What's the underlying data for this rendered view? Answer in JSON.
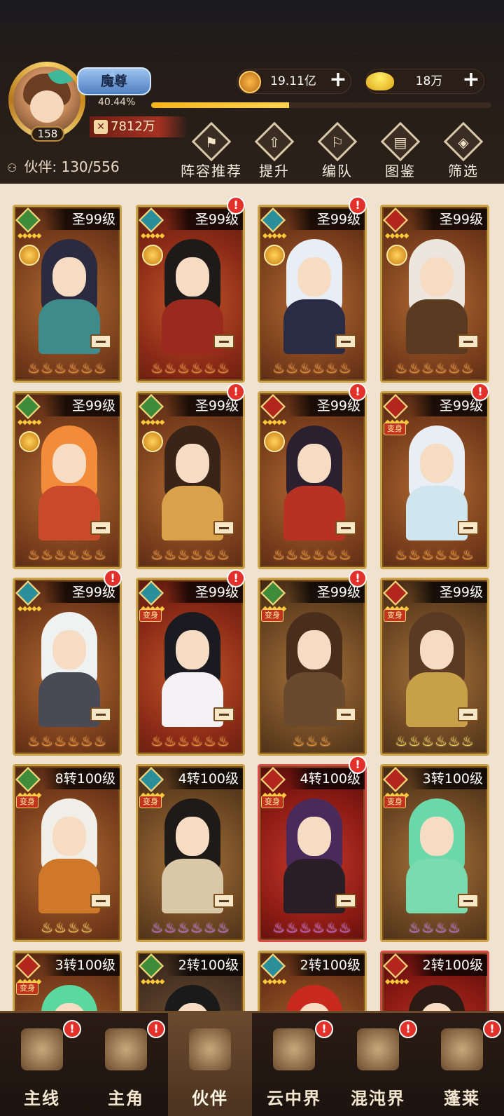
{
  "player": {
    "level": "158",
    "rank": "魔尊",
    "exp_percent": "40.44%",
    "exp_fraction": 0.4044,
    "power": "7812万"
  },
  "currency": {
    "coins": "19.11亿",
    "ingots": "18万"
  },
  "partners": {
    "label": "伙伴:",
    "count": "130/556"
  },
  "toolbar": [
    {
      "label": "阵容推荐",
      "icon": "lineup-icon"
    },
    {
      "label": "提升",
      "icon": "upgrade-icon"
    },
    {
      "label": "编队",
      "icon": "formation-icon"
    },
    {
      "label": "图鉴",
      "icon": "codex-icon"
    },
    {
      "label": "筛选",
      "icon": "filter-icon"
    }
  ],
  "transform_label": "变身",
  "alert_glyph": "!",
  "cards": [
    {
      "level": "圣99级",
      "element": "green",
      "bg": "d",
      "flames": "orange",
      "flame_count": 6,
      "medal": true,
      "hair": "#2b2a3e",
      "body": "#3f8a8a",
      "alert": false
    },
    {
      "level": "圣99级",
      "element": "teal",
      "bg": "r",
      "flames": "orange",
      "flame_count": 6,
      "medal": true,
      "hair": "#1e1a1a",
      "body": "#9a2a1e",
      "alert": true
    },
    {
      "level": "圣99级",
      "element": "teal",
      "bg": "d",
      "flames": "orange",
      "flame_count": 6,
      "medal": true,
      "hair": "#e8eef6",
      "body": "#2a2b44",
      "alert": true
    },
    {
      "level": "圣99级",
      "element": "red",
      "bg": "d",
      "flames": "orange",
      "flame_count": 6,
      "medal": true,
      "hair": "#ece6de",
      "body": "#5a3a20",
      "alert": false
    },
    {
      "level": "圣99级",
      "element": "green",
      "bg": "d",
      "flames": "orange",
      "flame_count": 6,
      "medal": true,
      "hair": "#f28c3a",
      "body": "#c84a2a",
      "alert": false
    },
    {
      "level": "圣99级",
      "element": "green",
      "bg": "d",
      "flames": "orange",
      "flame_count": 6,
      "medal": true,
      "hair": "#3a2418",
      "body": "#d9a24a",
      "alert": true
    },
    {
      "level": "圣99级",
      "element": "red",
      "bg": "d",
      "flames": "orange",
      "flame_count": 6,
      "medal": true,
      "hair": "#2a2030",
      "body": "#b83224",
      "alert": true
    },
    {
      "level": "圣99级",
      "element": "red",
      "bg": "d",
      "flames": "orange",
      "flame_count": 6,
      "medal": false,
      "transform": true,
      "hair": "#e8eef4",
      "body": "#cfe6ee",
      "alert": true
    },
    {
      "level": "圣99级",
      "element": "teal",
      "bg": "d",
      "flames": "orange",
      "flame_count": 6,
      "medal": false,
      "hair": "#f0f2f2",
      "body": "#4a4a56",
      "alert": true
    },
    {
      "level": "圣99级",
      "element": "teal",
      "bg": "r",
      "flames": "orange",
      "flame_count": 6,
      "medal": false,
      "transform": true,
      "hair": "#1a1a20",
      "body": "#f4f2f4",
      "alert": true
    },
    {
      "level": "圣99级",
      "element": "green",
      "bg": "g",
      "flames": "orange",
      "flame_count": 3,
      "medal": false,
      "transform": true,
      "hair": "#4a2e1c",
      "body": "#6a4a2e",
      "alert": true
    },
    {
      "level": "圣99级",
      "element": "red",
      "bg": "g",
      "flames": "gold",
      "flame_count": 6,
      "medal": false,
      "transform": true,
      "hair": "#5a3a22",
      "body": "#c9a04a",
      "alert": false
    },
    {
      "level": "8转100级",
      "element": "green",
      "bg": "d",
      "flames": "gold",
      "flame_count": 4,
      "medal": false,
      "transform": true,
      "hair": "#f0eee6",
      "body": "#d0782a",
      "alert": false
    },
    {
      "level": "4转100级",
      "element": "teal",
      "bg": "g",
      "flames": "purple",
      "flame_count": 6,
      "medal": false,
      "transform": true,
      "hair": "#1e1a18",
      "body": "#d8c8a8",
      "alert": false
    },
    {
      "level": "4转100级",
      "element": "red",
      "bg": "crimson",
      "flames": "purple",
      "flame_count": 6,
      "medal": false,
      "transform": true,
      "hair": "#4a2a5a",
      "body": "#2a1e26",
      "alert": true,
      "pink": true
    },
    {
      "level": "3转100级",
      "element": "red",
      "bg": "g",
      "flames": "purple",
      "flame_count": 4,
      "medal": false,
      "transform": true,
      "hair": "#6ad8a8",
      "body": "#7adcae",
      "alert": false
    },
    {
      "level": "3转100级",
      "element": "red",
      "bg": "d",
      "flames": "orange",
      "flame_count": 0,
      "medal": false,
      "transform": true,
      "hair": "#5ad8a0",
      "body": "#a85a2a",
      "alert": false
    },
    {
      "level": "2转100级",
      "element": "green",
      "bg": "grey",
      "flames": "orange",
      "flame_count": 0,
      "medal": false,
      "hair": "#1a1a1a",
      "body": "#3a2a22",
      "alert": false
    },
    {
      "level": "2转100级",
      "element": "teal",
      "bg": "d",
      "flames": "orange",
      "flame_count": 0,
      "medal": false,
      "hair": "#c82a1e",
      "body": "#8a2a1a",
      "alert": false
    },
    {
      "level": "2转100级",
      "element": "red",
      "bg": "crimson",
      "flames": "orange",
      "flame_count": 0,
      "medal": false,
      "hair": "#2a1c14",
      "body": "#f2ece2",
      "alert": false,
      "pink": true
    }
  ],
  "nav": [
    {
      "label": "主线",
      "icon": "crossed-swords-icon",
      "alert": true,
      "active": false
    },
    {
      "label": "主角",
      "icon": "hero-icon",
      "alert": true,
      "active": false
    },
    {
      "label": "伙伴",
      "icon": "partner-icon",
      "alert": false,
      "active": true
    },
    {
      "label": "云中界",
      "icon": "cloud-realm-icon",
      "alert": true,
      "active": false
    },
    {
      "label": "混沌界",
      "icon": "chaos-realm-icon",
      "alert": true,
      "active": false
    },
    {
      "label": "蓬莱",
      "icon": "penglai-icon",
      "alert": true,
      "active": false
    }
  ]
}
